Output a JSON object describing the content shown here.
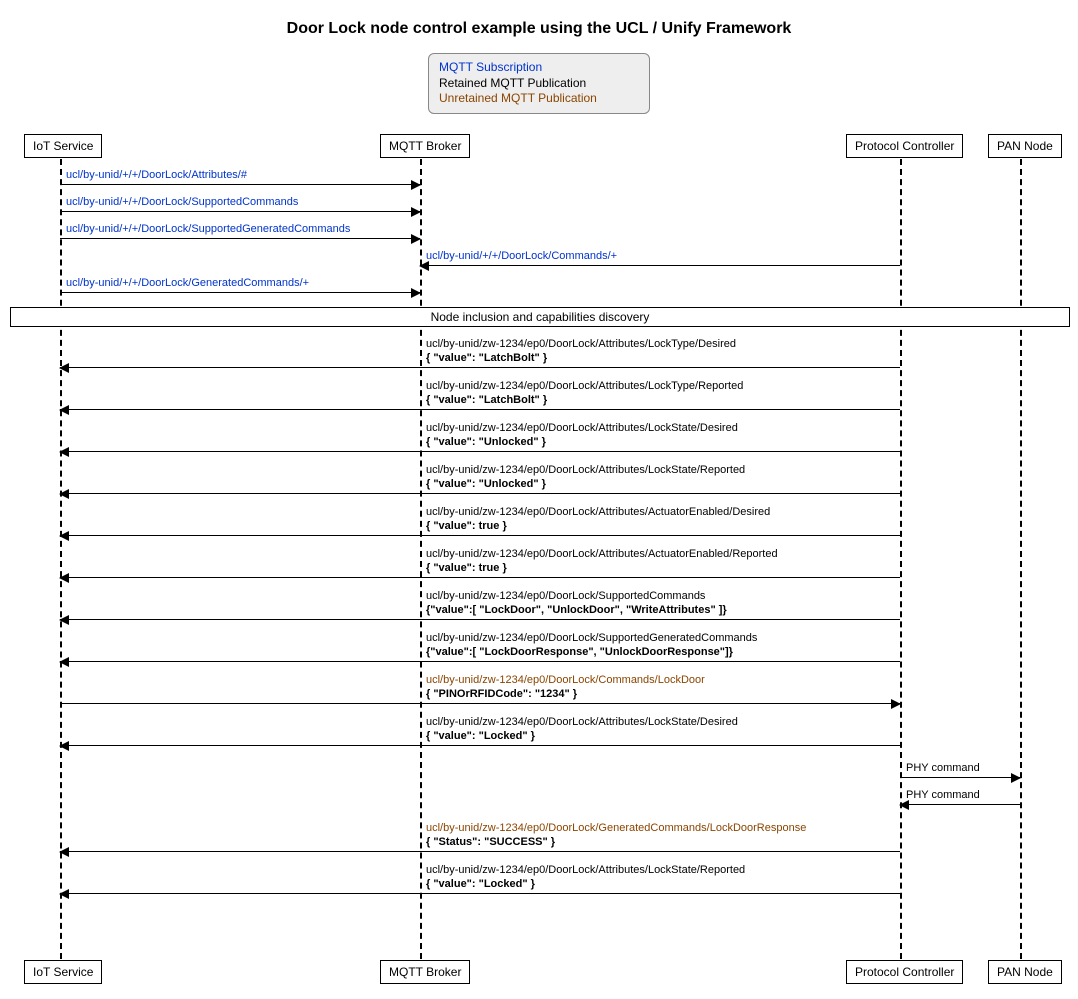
{
  "title": "Door Lock node control example using the UCL / Unify Framework",
  "legend": {
    "sub": "MQTT Subscription",
    "retained": "Retained MQTT Publication",
    "unretained": "Unretained MQTT Publication"
  },
  "actors": {
    "iot": "IoT Service",
    "broker": "MQTT Broker",
    "controller": "Protocol Controller",
    "node": "PAN Node"
  },
  "divider": "Node inclusion and capabilities discovery",
  "messages": {
    "m1": "ucl/by-unid/+/+/DoorLock/Attributes/#",
    "m2": "ucl/by-unid/+/+/DoorLock/SupportedCommands",
    "m3": "ucl/by-unid/+/+/DoorLock/SupportedGeneratedCommands",
    "m4": "ucl/by-unid/+/+/DoorLock/Commands/+",
    "m5": "ucl/by-unid/+/+/DoorLock/GeneratedCommands/+",
    "m6t": "ucl/by-unid/zw-1234/ep0/DoorLock/Attributes/LockType/Desired",
    "m6p": "{ \"value\": \"LatchBolt\" }",
    "m7t": "ucl/by-unid/zw-1234/ep0/DoorLock/Attributes/LockType/Reported",
    "m7p": "{ \"value\": \"LatchBolt\" }",
    "m8t": "ucl/by-unid/zw-1234/ep0/DoorLock/Attributes/LockState/Desired",
    "m8p": "{ \"value\": \"Unlocked\" }",
    "m9t": "ucl/by-unid/zw-1234/ep0/DoorLock/Attributes/LockState/Reported",
    "m9p": "{ \"value\": \"Unlocked\" }",
    "m10t": "ucl/by-unid/zw-1234/ep0/DoorLock/Attributes/ActuatorEnabled/Desired",
    "m10p": "{ \"value\": true }",
    "m11t": "ucl/by-unid/zw-1234/ep0/DoorLock/Attributes/ActuatorEnabled/Reported",
    "m11p": "{ \"value\": true }",
    "m12t": "ucl/by-unid/zw-1234/ep0/DoorLock/SupportedCommands",
    "m12p": "{\"value\":[ \"LockDoor\", \"UnlockDoor\", \"WriteAttributes\" ]}",
    "m13t": "ucl/by-unid/zw-1234/ep0/DoorLock/SupportedGeneratedCommands",
    "m13p": "{\"value\":[ \"LockDoorResponse\", \"UnlockDoorResponse\"]}",
    "m14t": "ucl/by-unid/zw-1234/ep0/DoorLock/Commands/LockDoor",
    "m14p": "{ \"PINOrRFIDCode\": \"1234\" }",
    "m15t": "ucl/by-unid/zw-1234/ep0/DoorLock/Attributes/LockState/Desired",
    "m15p": "{ \"value\": \"Locked\" }",
    "m16": "PHY command",
    "m17": "PHY command",
    "m18t": "ucl/by-unid/zw-1234/ep0/DoorLock/GeneratedCommands/LockDoorResponse",
    "m18p": "{ \"Status\": \"SUCCESS\" }",
    "m19t": "ucl/by-unid/zw-1234/ep0/DoorLock/Attributes/LockState/Reported",
    "m19p": "{ \"value\": \"Locked\" }"
  },
  "chart_data": {
    "type": "sequence-diagram",
    "participants": [
      "IoT Service",
      "MQTT Broker",
      "Protocol Controller",
      "PAN Node"
    ],
    "legend_colors": {
      "MQTT Subscription": "blue",
      "Retained MQTT Publication": "black",
      "Unretained MQTT Publication": "brown"
    },
    "events": [
      {
        "from": "IoT Service",
        "to": "MQTT Broker",
        "kind": "subscription",
        "topic": "ucl/by-unid/+/+/DoorLock/Attributes/#"
      },
      {
        "from": "IoT Service",
        "to": "MQTT Broker",
        "kind": "subscription",
        "topic": "ucl/by-unid/+/+/DoorLock/SupportedCommands"
      },
      {
        "from": "IoT Service",
        "to": "MQTT Broker",
        "kind": "subscription",
        "topic": "ucl/by-unid/+/+/DoorLock/SupportedGeneratedCommands"
      },
      {
        "from": "Protocol Controller",
        "to": "MQTT Broker",
        "kind": "subscription",
        "topic": "ucl/by-unid/+/+/DoorLock/Commands/+"
      },
      {
        "from": "IoT Service",
        "to": "MQTT Broker",
        "kind": "subscription",
        "topic": "ucl/by-unid/+/+/DoorLock/GeneratedCommands/+"
      },
      {
        "divider": "Node inclusion and capabilities discovery"
      },
      {
        "from": "Protocol Controller",
        "to": "IoT Service",
        "kind": "retained",
        "topic": "ucl/by-unid/zw-1234/ep0/DoorLock/Attributes/LockType/Desired",
        "payload": {
          "value": "LatchBolt"
        }
      },
      {
        "from": "Protocol Controller",
        "to": "IoT Service",
        "kind": "retained",
        "topic": "ucl/by-unid/zw-1234/ep0/DoorLock/Attributes/LockType/Reported",
        "payload": {
          "value": "LatchBolt"
        }
      },
      {
        "from": "Protocol Controller",
        "to": "IoT Service",
        "kind": "retained",
        "topic": "ucl/by-unid/zw-1234/ep0/DoorLock/Attributes/LockState/Desired",
        "payload": {
          "value": "Unlocked"
        }
      },
      {
        "from": "Protocol Controller",
        "to": "IoT Service",
        "kind": "retained",
        "topic": "ucl/by-unid/zw-1234/ep0/DoorLock/Attributes/LockState/Reported",
        "payload": {
          "value": "Unlocked"
        }
      },
      {
        "from": "Protocol Controller",
        "to": "IoT Service",
        "kind": "retained",
        "topic": "ucl/by-unid/zw-1234/ep0/DoorLock/Attributes/ActuatorEnabled/Desired",
        "payload": {
          "value": true
        }
      },
      {
        "from": "Protocol Controller",
        "to": "IoT Service",
        "kind": "retained",
        "topic": "ucl/by-unid/zw-1234/ep0/DoorLock/Attributes/ActuatorEnabled/Reported",
        "payload": {
          "value": true
        }
      },
      {
        "from": "Protocol Controller",
        "to": "IoT Service",
        "kind": "retained",
        "topic": "ucl/by-unid/zw-1234/ep0/DoorLock/SupportedCommands",
        "payload": {
          "value": [
            "LockDoor",
            "UnlockDoor",
            "WriteAttributes"
          ]
        }
      },
      {
        "from": "Protocol Controller",
        "to": "IoT Service",
        "kind": "retained",
        "topic": "ucl/by-unid/zw-1234/ep0/DoorLock/SupportedGeneratedCommands",
        "payload": {
          "value": [
            "LockDoorResponse",
            "UnlockDoorResponse"
          ]
        }
      },
      {
        "from": "IoT Service",
        "to": "Protocol Controller",
        "kind": "unretained",
        "topic": "ucl/by-unid/zw-1234/ep0/DoorLock/Commands/LockDoor",
        "payload": {
          "PINOrRFIDCode": "1234"
        }
      },
      {
        "from": "Protocol Controller",
        "to": "IoT Service",
        "kind": "retained",
        "topic": "ucl/by-unid/zw-1234/ep0/DoorLock/Attributes/LockState/Desired",
        "payload": {
          "value": "Locked"
        }
      },
      {
        "from": "Protocol Controller",
        "to": "PAN Node",
        "kind": "phy",
        "label": "PHY command"
      },
      {
        "from": "PAN Node",
        "to": "Protocol Controller",
        "kind": "phy",
        "label": "PHY command"
      },
      {
        "from": "Protocol Controller",
        "to": "IoT Service",
        "kind": "unretained",
        "topic": "ucl/by-unid/zw-1234/ep0/DoorLock/GeneratedCommands/LockDoorResponse",
        "payload": {
          "Status": "SUCCESS"
        }
      },
      {
        "from": "Protocol Controller",
        "to": "IoT Service",
        "kind": "retained",
        "topic": "ucl/by-unid/zw-1234/ep0/DoorLock/Attributes/LockState/Reported",
        "payload": {
          "value": "Locked"
        }
      }
    ]
  }
}
